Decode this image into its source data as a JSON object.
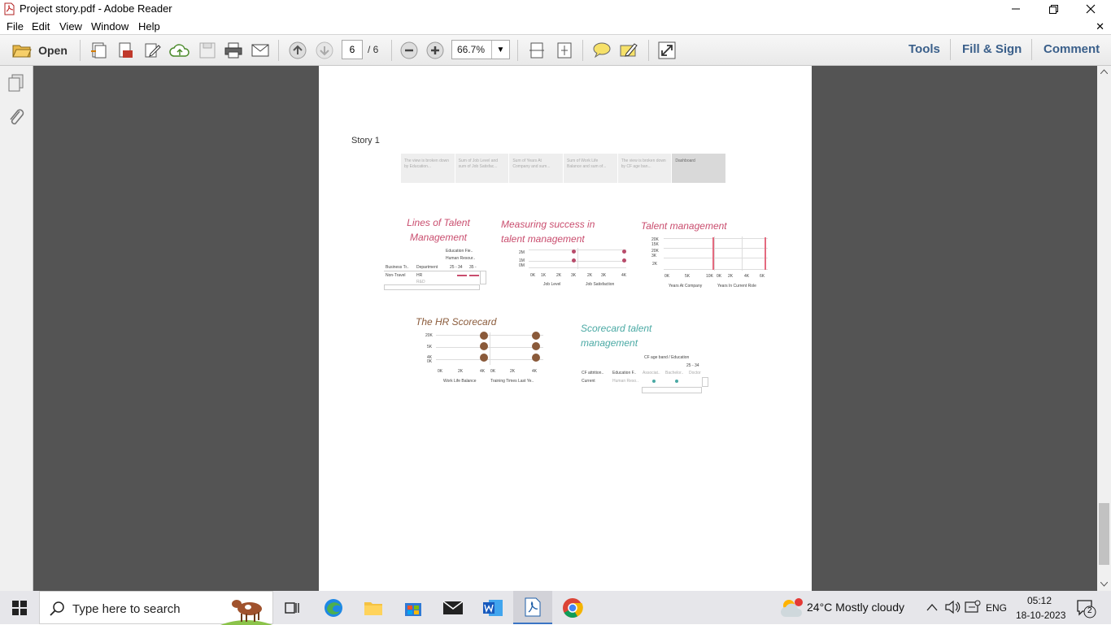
{
  "window": {
    "title": "Project story.pdf - Adobe Reader"
  },
  "menu": [
    "File",
    "Edit",
    "View",
    "Window",
    "Help"
  ],
  "toolbar": {
    "open_label": "Open",
    "page_current": "6",
    "page_total": "/ 6",
    "zoom": "66.7%",
    "right": [
      "Tools",
      "Fill & Sign",
      "Comment"
    ]
  },
  "document": {
    "story_title": "Story 1",
    "tabs": [
      "The view is broken down by Education...",
      "Sum of Job Level and sum of Job Satisfac...",
      "Sum of Years At Company and sum...",
      "Sum of Work Life Balance and sum of...",
      "The view is broken down by CF age ban...",
      "Dashboard"
    ],
    "viz": {
      "lines": {
        "title": "Lines of Talent Management",
        "headers": [
          "Education Fie..",
          "Human Resour..",
          "Business Tr..",
          "Department",
          "25 - 34",
          "35 -"
        ],
        "rows": [
          "Non-Travel",
          "HR",
          "R&D"
        ]
      },
      "measuring": {
        "title": "Measuring success in talent management",
        "axis": [
          "0K",
          "1K",
          "2K",
          "3K",
          "2K",
          "3K",
          "4K"
        ],
        "ylabels": [
          "2M",
          "1M",
          "0M"
        ],
        "xlabels": [
          "Job Level",
          "Job Satisfaction"
        ]
      },
      "talent": {
        "title": "Talent management",
        "ylabels": [
          "20K",
          "15K",
          "20K",
          "3K",
          "2K"
        ],
        "axis": [
          "0K",
          "5K",
          "10K",
          "0K",
          "2K",
          "4K",
          "6K"
        ],
        "xlabels": [
          "Years At Company",
          "Years In Current Role"
        ]
      },
      "hr": {
        "title": "The HR Scorecard",
        "ylabels": [
          "20K",
          "5K",
          "4K",
          "0K"
        ],
        "axis": [
          "0K",
          "2K",
          "4K",
          "0K",
          "2K",
          "4K"
        ],
        "xlabels": [
          "Work Life Balance",
          "Training Times Last Ye.."
        ]
      },
      "scorecard": {
        "title": "Scorecard talent management",
        "header": "CF age band / Education",
        "subheader": "25 - 34",
        "cols": [
          "CF attrition..",
          "Education F..",
          "Associat..",
          "Bachelor..",
          "Doctor"
        ],
        "rows": [
          "Current",
          "Human Reso.."
        ]
      }
    }
  },
  "taskbar": {
    "search_placeholder": "Type here to search",
    "weather": "24°C  Mostly cloudy",
    "lang": "ENG",
    "time": "05:12",
    "date": "18-10-2023",
    "notifications": "2"
  },
  "colors": {
    "accent_red": "#c94d6e",
    "accent_brown": "#8a5a3a",
    "accent_teal": "#4aa9a4",
    "viz_red": "#b84b6a"
  }
}
